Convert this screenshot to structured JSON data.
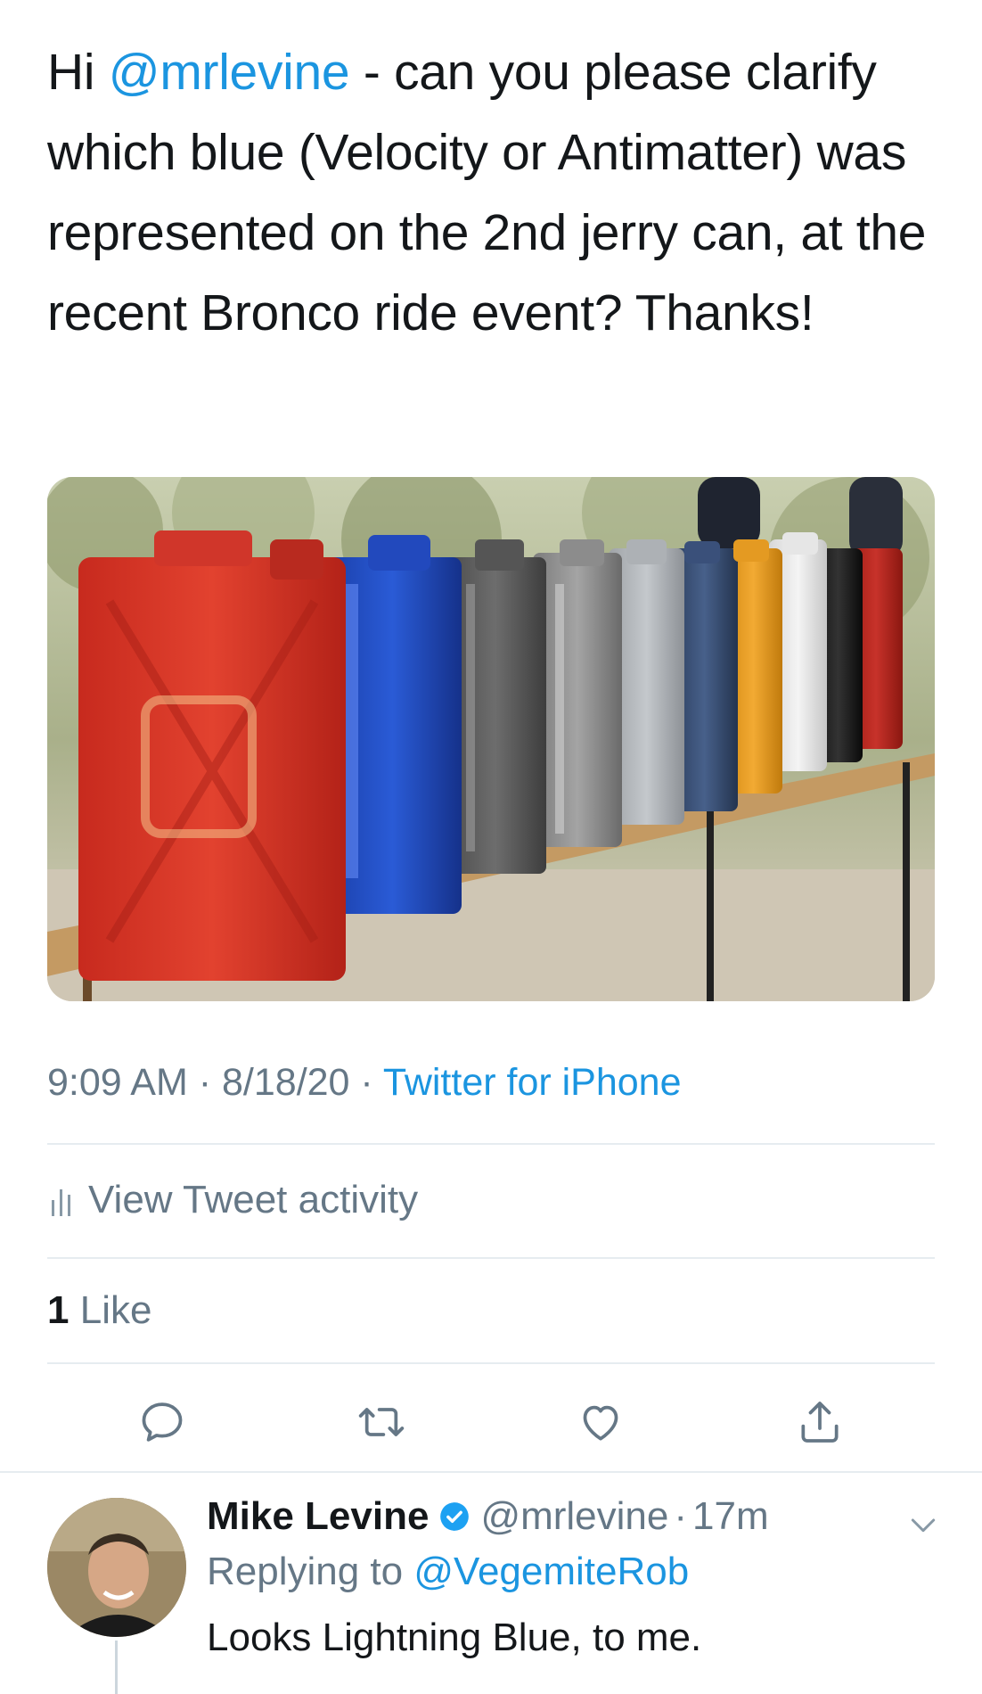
{
  "tweet": {
    "text_prefix": "Hi ",
    "mention": "@mrlevine",
    "text_rest": " - can you please clarify which blue (Velocity or Antimatter) was represented on the 2nd jerry can, at the recent Bronco ride event? Thanks!",
    "time": "9:09 AM",
    "date": "8/18/20",
    "separator": "·",
    "source": "Twitter for iPhone",
    "activity_label": "View Tweet activity",
    "like_count": "1",
    "like_label": "Like"
  },
  "actions": {
    "reply_icon": "comment-icon",
    "retweet_icon": "retweet-icon",
    "like_icon": "heart-icon",
    "share_icon": "share-icon"
  },
  "reply": {
    "name": "Mike Levine",
    "verified_icon": "verified-badge-icon",
    "handle": "@mrlevine",
    "separator": "·",
    "time": "17m",
    "replying_label": "Replying to",
    "replying_to": "@VegemiteRob",
    "text": "Looks Lightning Blue, to me."
  },
  "colors": {
    "link_blue": "#1b95e0",
    "text_primary": "#14171a",
    "text_secondary": "#657786",
    "divider": "#e6ecf0"
  }
}
